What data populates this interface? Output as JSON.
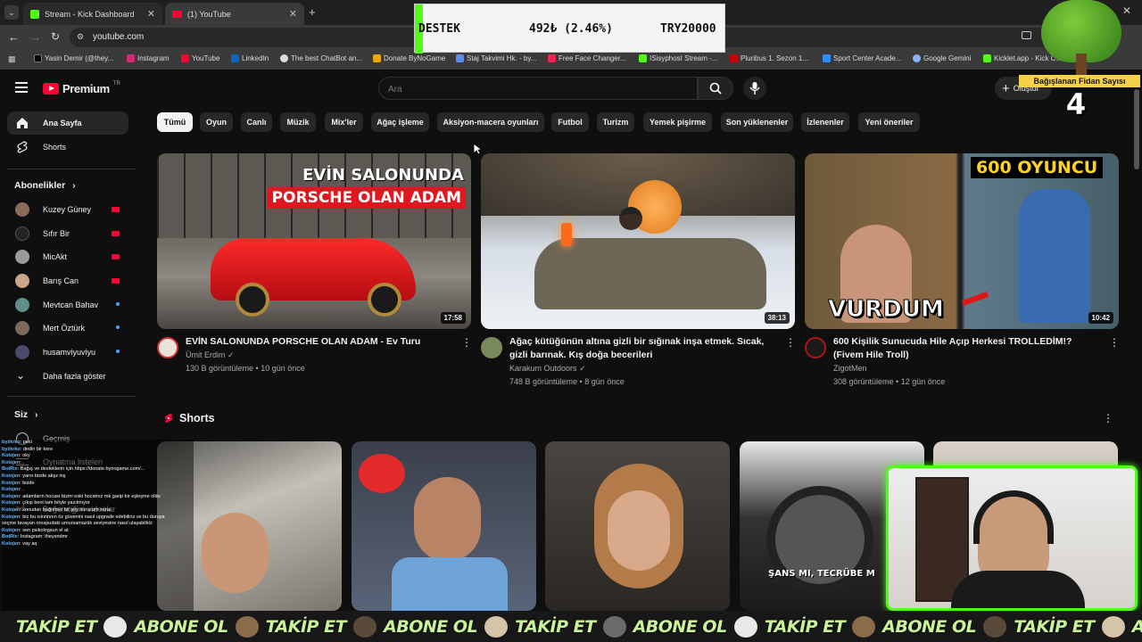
{
  "browser": {
    "tabs": [
      {
        "title": "Stream - Kick Dashboard"
      },
      {
        "title": "(1) YouTube"
      }
    ],
    "url": "youtube.com",
    "bookmarks": [
      {
        "label": "Yasin Demir (@they..."
      },
      {
        "label": "Instagram"
      },
      {
        "label": "YouTube"
      },
      {
        "label": "LinkedIn"
      },
      {
        "label": "The best ChatBot an..."
      },
      {
        "label": "Donate ByNoGame"
      },
      {
        "label": "Staj Takvimi Hk. - by..."
      },
      {
        "label": "Free Face Changer..."
      },
      {
        "label": "ISisyphosI Stream -..."
      },
      {
        "label": "Pluribus 1. Sezon 1..."
      },
      {
        "label": "Sport Center Acade..."
      },
      {
        "label": "Google Gemini"
      },
      {
        "label": "Kicklet.app - Kick C..."
      }
    ]
  },
  "donation_widget": {
    "label": "DESTEK",
    "value": "492₺ (2.46%)",
    "goal": "TRY20000",
    "progress_fraction": 0.0246
  },
  "tree_widget": {
    "label": "Bağışlanan Fidan Sayısı",
    "count": "4"
  },
  "youtube": {
    "logo_text": "Premium",
    "logo_badge": "TR",
    "search_placeholder": "Ara",
    "create_label": "Oluştur",
    "sidebar": {
      "main": [
        {
          "label": "Ana Sayfa",
          "icon": "home-icon"
        },
        {
          "label": "Shorts",
          "icon": "shorts-icon"
        }
      ],
      "subs_header": "Abonelikler",
      "subscriptions": [
        {
          "label": "Kuzey Güney",
          "color": "#8a6b5a",
          "status": "live"
        },
        {
          "label": "Sıfır Bir",
          "color": "#222222",
          "status": "live"
        },
        {
          "label": "MicAkt",
          "color": "#9a9a9a",
          "status": "live"
        },
        {
          "label": "Barış Can",
          "color": "#c9a58a",
          "status": "live"
        },
        {
          "label": "Mevtcan Bahav",
          "color": "#5f8f8a",
          "status": "new"
        },
        {
          "label": "Mert Öztürk",
          "color": "#7a6a5a",
          "status": "new"
        },
        {
          "label": "husamviyuviyu",
          "color": "#4a4a6a",
          "status": "new"
        }
      ],
      "more_label": "Daha fazla göster",
      "you_header": "Siz",
      "you_items": [
        {
          "label": "Geçmiş"
        },
        {
          "label": "Oynatma listeleri"
        },
        {
          "label": "Beğendiğim videolar"
        }
      ]
    },
    "chips": [
      "Tümü",
      "Oyun",
      "Canlı",
      "Müzik",
      "Mix'ler",
      "Ağaç işleme",
      "Aksiyon-macera oyunları",
      "Futbol",
      "Turizm",
      "Yemek pişirme",
      "Son yüklenenler",
      "İzlenenler",
      "Yeni öneriler"
    ],
    "videos": [
      {
        "title": "EVİN SALONUNDA PORSCHE OLAN ADAM - Ev Turu",
        "channel": "Ümit Erdim",
        "meta": "130 B görüntüleme • 10 gün önce",
        "duration": "17:58",
        "thumb_line1": "EVİN SALONUNDA",
        "thumb_line2": "PORSCHE OLAN ADAM"
      },
      {
        "title": "Ağaç kütüğünün altına gizli bir sığınak inşa etmek. Sıcak, gizli barınak. Kış doğa becerileri",
        "channel": "Karakum Outdoors",
        "meta": "748 B görüntüleme • 8 gün önce",
        "duration": "38:13"
      },
      {
        "title": "600 Kişilik Sunucuda Hile Açıp Herkesi TROLLEDİM!? (Fivem Hile Troll)",
        "channel": "ZigotMen",
        "meta": "308 görüntüleme • 12 gün önce",
        "duration": "10:42",
        "thumb_top": "600 OYUNCU",
        "thumb_bottom": "VURDUM"
      }
    ],
    "shorts_header": "Shorts",
    "short_overlay_text": "ŞANS MI, TECRÜBE M"
  },
  "chat": [
    {
      "user": "byżkrko",
      "msg": ": peki"
    },
    {
      "user": "byżkrko",
      "msg": ": dedin bir kere"
    },
    {
      "user": "Kolojen",
      "msg": ": oky"
    },
    {
      "user": "Kolojen",
      "msg": ": ."
    },
    {
      "user": "BotRix",
      "msg": ": Bağış ve desteklerin için https://donate.bynogame.com/..."
    },
    {
      "user": "Kolojen",
      "msg": ": yarın bizde akşz inş"
    },
    {
      "user": "Kolojen",
      "msg": ": bizde"
    },
    {
      "user": "Kolojen",
      "msg": ": ."
    },
    {
      "user": "Kolojen",
      "msg": ": adamların hocası bizim eski hocamız mk garip bir eşleşme oldu"
    },
    {
      "user": "Kolojen",
      "msg": ": çıkıp beni tam böyle yazılmıyor"
    },
    {
      "user": "Kolojen",
      "msg": ": konudan bağımsız bir şey sorucam sana"
    },
    {
      "user": "Kolojen",
      "msg": ": biz bu sıkıntının öz güvenini nasıl upgrade edebiliriz ve bu duruya"
    },
    {
      "user": "",
      "msg": "seçme tavayan orospudaki umursamazlık seviyesine nasıl ulaşabiliriz"
    },
    {
      "user": "Kolojen",
      "msg": ": sen psikologsun el at"
    },
    {
      "user": "BotRix",
      "msg": ": Instagram: theysndmr"
    },
    {
      "user": "Kolojen",
      "msg": ": vay aq"
    }
  ],
  "ticker": {
    "items": [
      "TAKİP ET",
      "ABONE OL",
      "TAKİP ET",
      "ABONE OL",
      "TAKİP ET",
      "ABONE OL",
      "TAKİP ET",
      "ABONE OL",
      "TAKİP ET",
      "ABONE OL"
    ]
  }
}
